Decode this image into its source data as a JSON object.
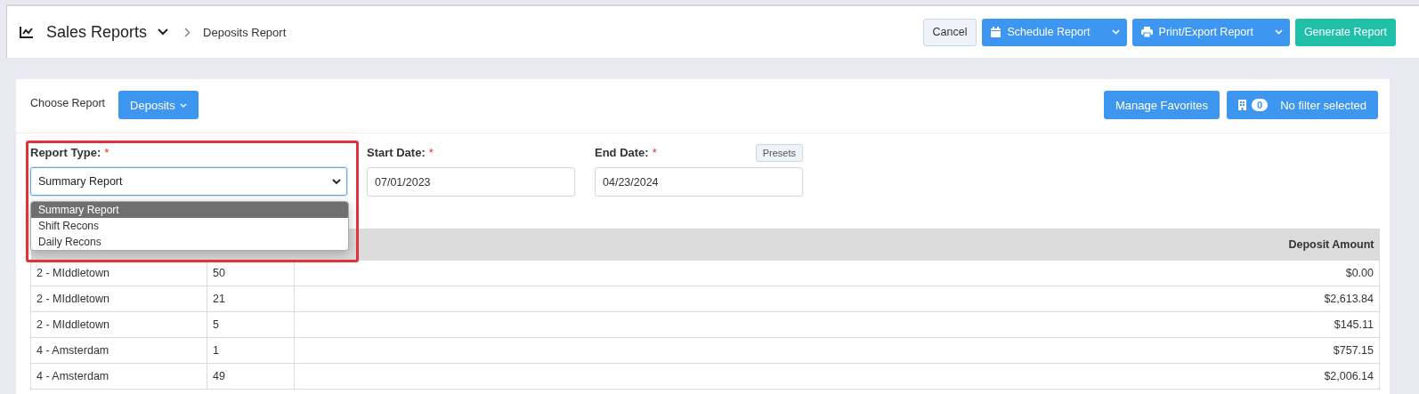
{
  "header": {
    "title": "Sales Reports",
    "breadcrumb": "Deposits Report",
    "buttons": [
      {
        "kind": "plain",
        "label": "Cancel"
      },
      {
        "kind": "split_calendar",
        "label": "Schedule Report"
      },
      {
        "kind": "split_printer",
        "label": "Print/Export Report"
      },
      {
        "kind": "primary",
        "label": "Generate Report"
      }
    ]
  },
  "toolbar": {
    "choose_label": "Choose Report",
    "report_button": "Deposits",
    "favorites_button": "Manage Favorites",
    "filter": {
      "count": "0",
      "label": "No filter selected"
    }
  },
  "form": {
    "report_type": {
      "label": "Report Type:",
      "required_mark": "*",
      "value": "Summary Report",
      "expanded": true,
      "options": [
        {
          "label": "Summary Report",
          "selected": true
        },
        {
          "label": "Shift Recons",
          "selected": false
        },
        {
          "label": "Daily Recons",
          "selected": false
        }
      ]
    },
    "start_date": {
      "label": "Start Date:",
      "required_mark": "*",
      "value": "07/01/2023"
    },
    "end_date": {
      "label": "End Date:",
      "required_mark": "*",
      "value": "04/23/2024"
    },
    "presets_button": "Presets"
  },
  "table": {
    "amount_header": "Deposit Amount",
    "rows": [
      [
        "2 - MIddletown",
        "50",
        "$0.00"
      ],
      [
        "2 - MIddletown",
        "21",
        "$2,613.84"
      ],
      [
        "2 - MIddletown",
        "5",
        "$145.11"
      ],
      [
        "4 - Amsterdam",
        "1",
        "$757.15"
      ],
      [
        "4 - Amsterdam",
        "49",
        "$2,006.14"
      ]
    ]
  }
}
